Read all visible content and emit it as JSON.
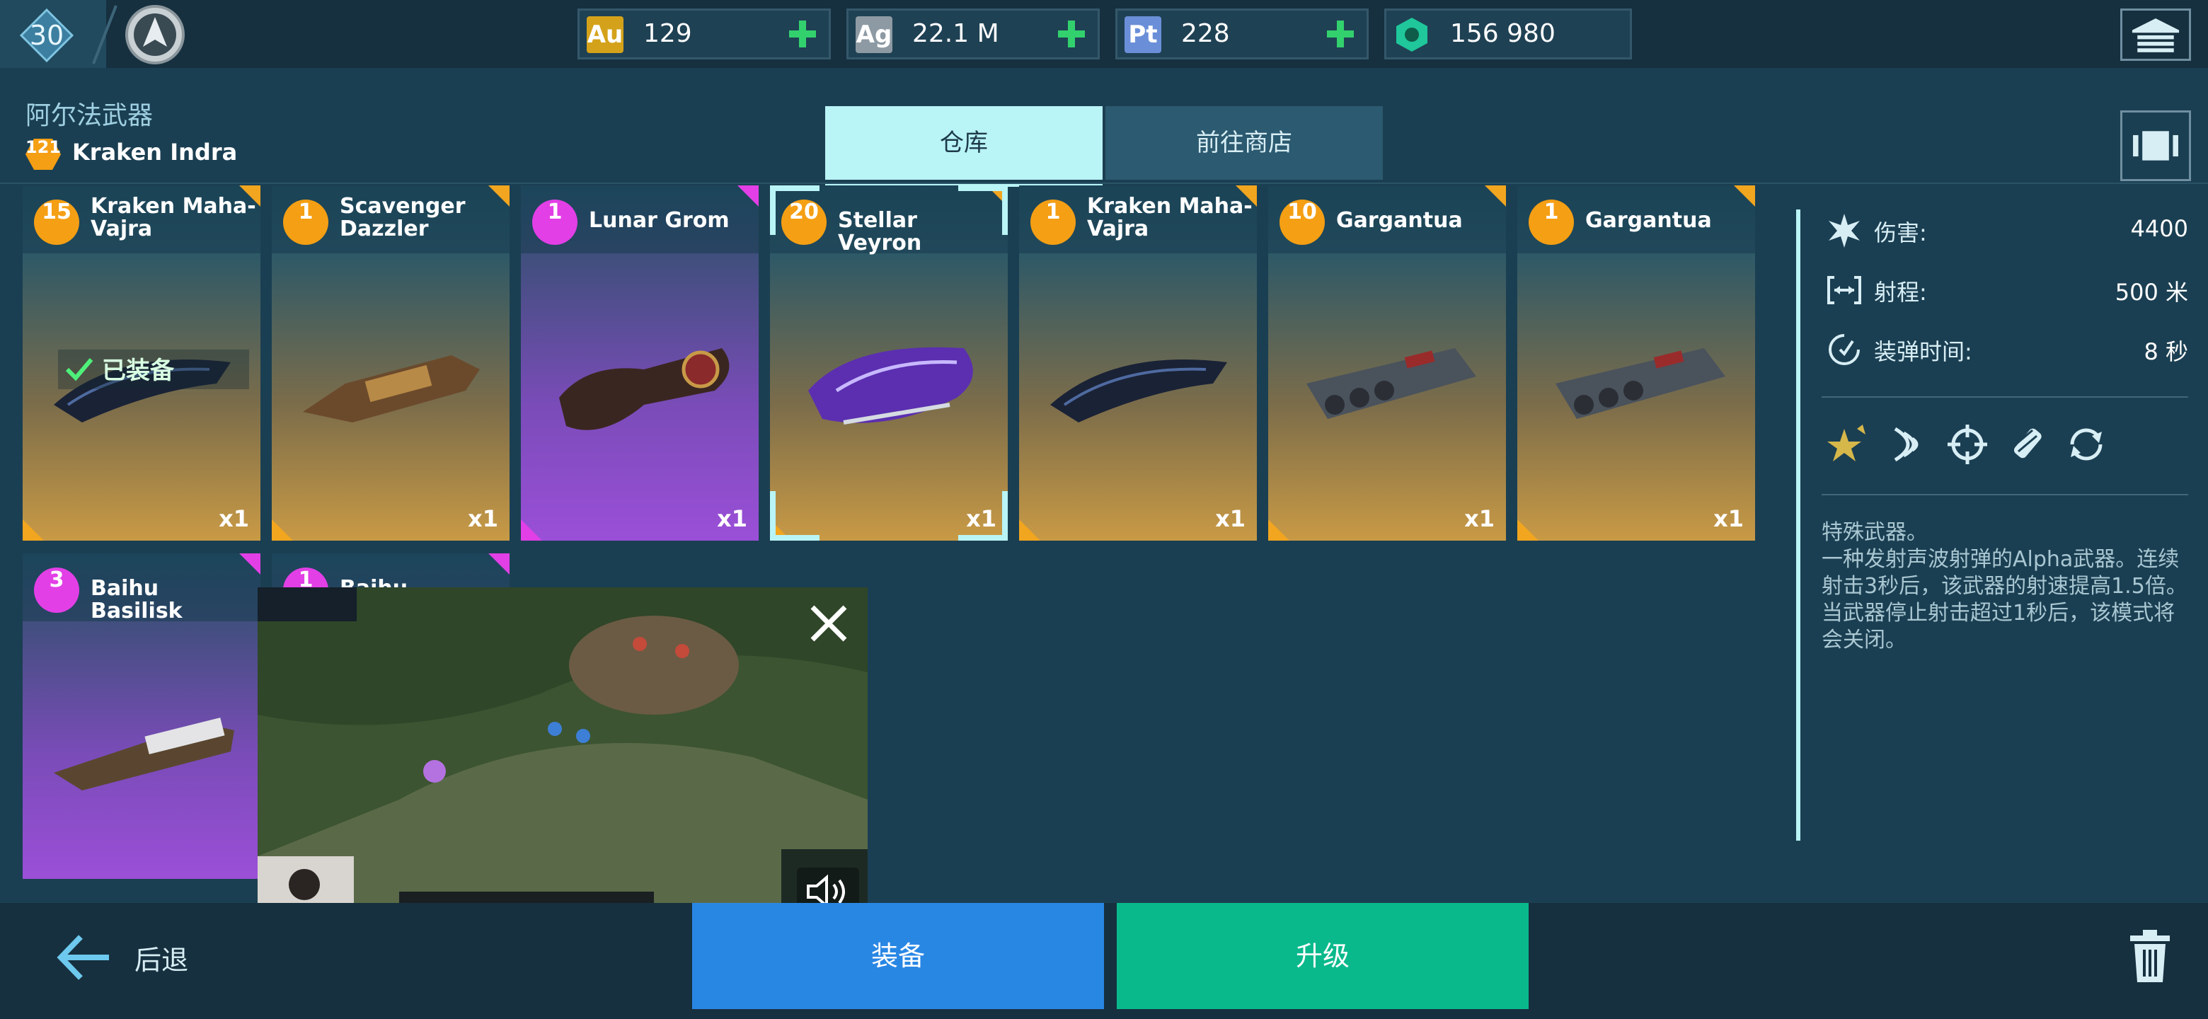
{
  "topbar": {
    "player_level": "30",
    "currencies": [
      {
        "code": "Au",
        "value": "129",
        "color": "#d4a21a"
      },
      {
        "code": "Ag",
        "value": "22.1 M",
        "color": "#8d9aa3"
      },
      {
        "code": "Pt",
        "value": "228",
        "color": "#6a8fd8"
      },
      {
        "code": "",
        "value": "156 980",
        "color": "#1fc79a"
      }
    ]
  },
  "header": {
    "section_title": "阿尔法武器",
    "ship_level": "121",
    "ship_name": "Kraken Indra",
    "tabs": [
      {
        "label": "仓库",
        "active": true
      },
      {
        "label": "前往商店",
        "active": false
      }
    ]
  },
  "weapons": [
    {
      "level": "15",
      "name": "Kraken Maha-Vajra",
      "qty": "x1",
      "rarity": "orange",
      "equipped_label": "已装备"
    },
    {
      "level": "1",
      "name": "Scavenger Dazzler",
      "qty": "x1",
      "rarity": "orange"
    },
    {
      "level": "1",
      "name": "Lunar Grom",
      "qty": "x1",
      "rarity": "purple"
    },
    {
      "level": "20",
      "name": "Stellar Veyron",
      "qty": "x1",
      "rarity": "orange",
      "selected": true
    },
    {
      "level": "1",
      "name": "Kraken Maha-Vajra",
      "qty": "x1",
      "rarity": "orange"
    },
    {
      "level": "10",
      "name": "Gargantua",
      "qty": "x1",
      "rarity": "orange"
    },
    {
      "level": "1",
      "name": "Gargantua",
      "qty": "x1",
      "rarity": "orange"
    },
    {
      "level": "3",
      "name": "Baihu Basilisk",
      "qty": "",
      "rarity": "purple"
    },
    {
      "level": "1",
      "name": "Baihu Basilisk",
      "qty": "",
      "rarity": "purple"
    }
  ],
  "details": {
    "stats": [
      {
        "icon": "damage-icon",
        "label": "伤害:",
        "value": "4400"
      },
      {
        "icon": "range-icon",
        "label": "射程:",
        "value": "500 米"
      },
      {
        "icon": "reload-icon",
        "label": "装弹时间:",
        "value": "8 秒"
      }
    ],
    "perks": [
      "star-perk-icon",
      "sonic-perk-icon",
      "crosshair-perk-icon",
      "ammo-perk-icon",
      "cycle-perk-icon"
    ],
    "description": "特殊武器。\n一种发射声波射弹的Alpha武器。连续射击3秒后，该武器的射速提高1.5倍。当武器停止射击超过1秒后，该模式将会关闭。"
  },
  "bottombar": {
    "back_label": "后退",
    "equip_label": "装备",
    "upgrade_label": "升级"
  }
}
